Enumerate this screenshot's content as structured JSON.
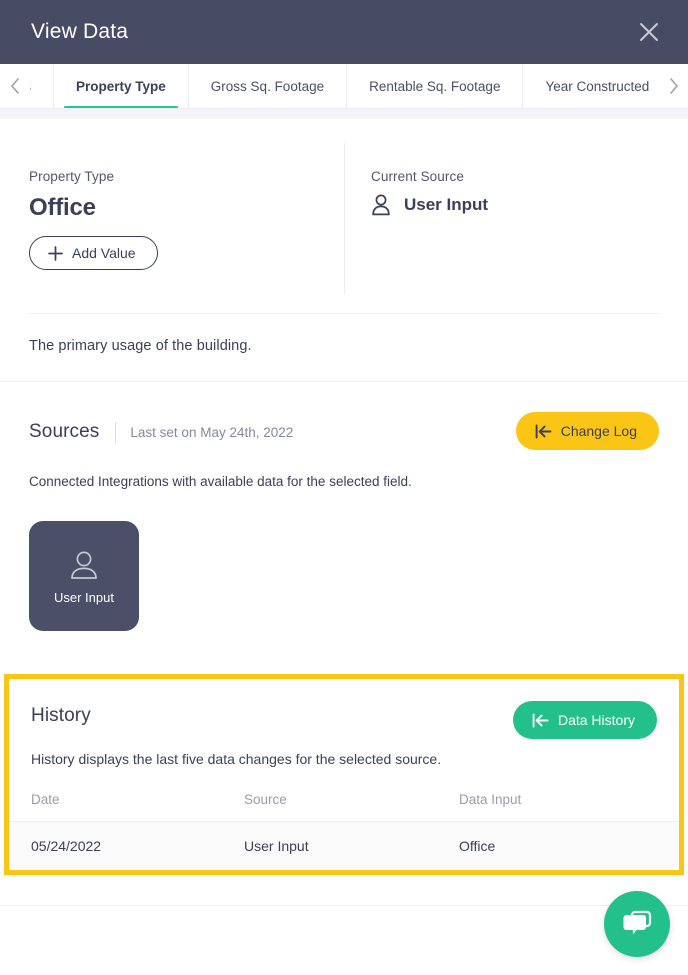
{
  "titlebar": {
    "title": "View Data",
    "close_icon": "close-icon"
  },
  "tabs": {
    "prev_icon": "chevron-left-icon",
    "next_icon": "chevron-right-icon",
    "items": [
      {
        "label": "dress",
        "full_label": "Address",
        "active": false,
        "clipped": true
      },
      {
        "label": "Property Type",
        "active": true,
        "clipped": false
      },
      {
        "label": "Gross Sq. Footage",
        "active": false,
        "clipped": false
      },
      {
        "label": "Rentable Sq. Footage",
        "active": false,
        "clipped": false
      },
      {
        "label": "Year Constructed",
        "active": false,
        "clipped": false
      }
    ]
  },
  "field": {
    "label": "Property Type",
    "value": "Office",
    "add_value_label": "Add Value",
    "plus_icon": "plus-icon"
  },
  "current_source": {
    "label": "Current Source",
    "value": "User Input",
    "icon": "person-icon"
  },
  "description": "The primary usage of the building.",
  "sources": {
    "title": "Sources",
    "last_set": "Last set on May 24th, 2022",
    "change_log_label": "Change Log",
    "change_log_icon": "skip-to-start-icon",
    "subtitle": "Connected Integrations with available data for the selected field.",
    "cards": [
      {
        "label": "User Input",
        "icon": "person-outline-icon",
        "selected": true
      }
    ]
  },
  "history": {
    "title": "History",
    "data_history_label": "Data History",
    "data_history_icon": "skip-to-start-icon",
    "description": "History displays the last five data changes for the selected source.",
    "columns": [
      "Date",
      "Source",
      "Data Input"
    ],
    "rows": [
      {
        "date": "05/24/2022",
        "source": "User Input",
        "data_input": "Office"
      }
    ]
  },
  "chat": {
    "icon": "chat-bubbles-icon"
  },
  "colors": {
    "header_bg": "#474b63",
    "accent_green": "#20c997",
    "button_green": "#23c08b",
    "accent_yellow": "#fbc516",
    "highlight_border": "#fbc516",
    "text_dark": "#3b3f57",
    "text_muted": "#9a9cab"
  }
}
